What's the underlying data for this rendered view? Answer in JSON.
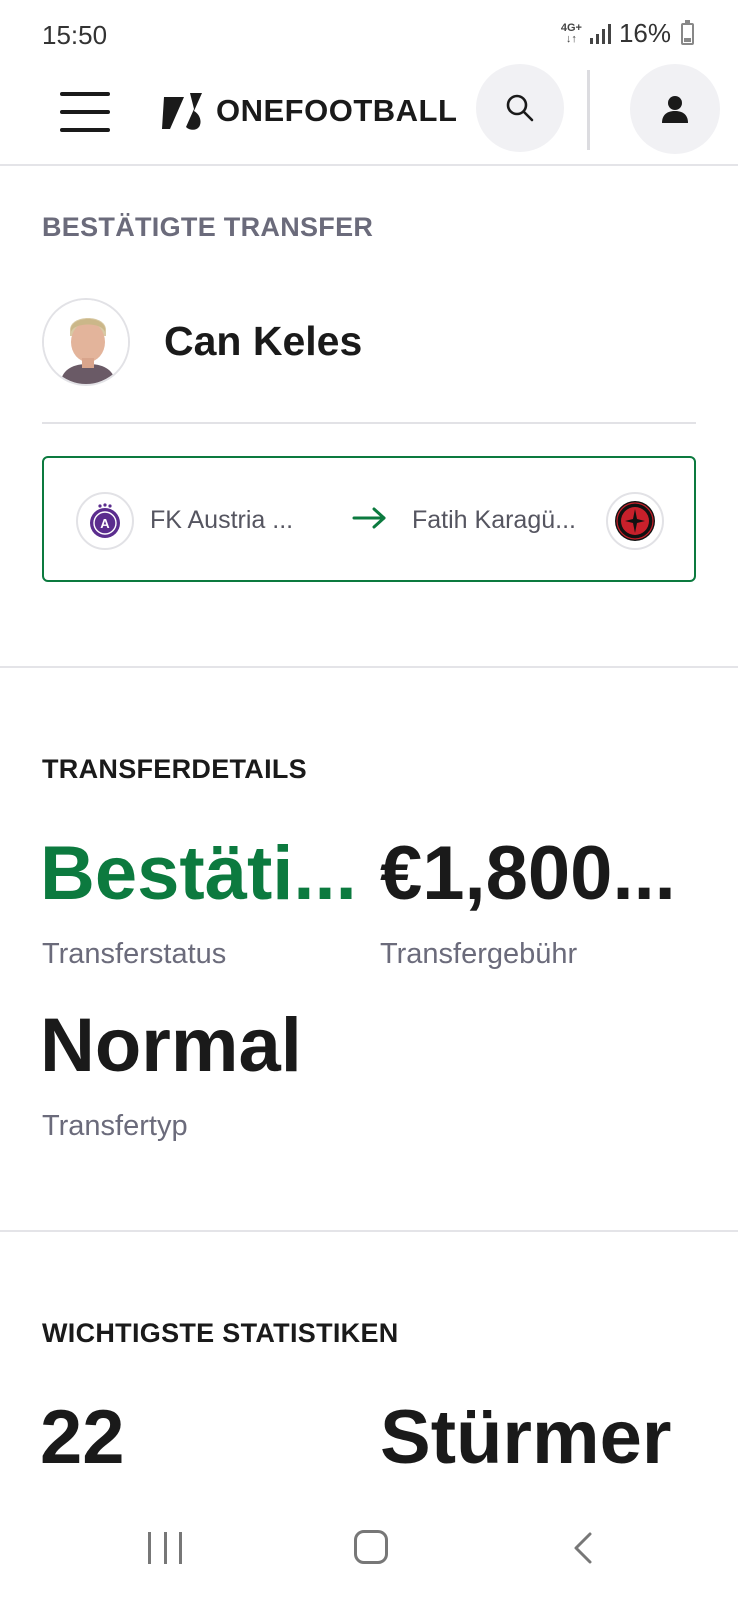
{
  "status_bar": {
    "time": "15:50",
    "network": "4G+",
    "battery": "16%"
  },
  "header": {
    "brand": "ONEFOOTBALL",
    "menu_icon": "hamburger-menu-icon",
    "search_icon": "search-icon",
    "profile_icon": "user-icon"
  },
  "confirmed_transfer": {
    "label": "BESTÄTIGTE TRANSFER",
    "player_name": "Can Keles",
    "from_club": "FK Austria ...",
    "to_club": "Fatih Karagü...",
    "accent_color": "#0c7a3f"
  },
  "transfer_details": {
    "heading": "TRANSFERDETAILS",
    "status_value": "Bestäti...",
    "status_caption": "Transferstatus",
    "fee_value": "€1,800...",
    "fee_caption": "Transfergebühr",
    "type_value": "Normal",
    "type_caption": "Transfertyp"
  },
  "key_stats": {
    "heading": "WICHTIGSTE STATISTIKEN",
    "age_value": "22",
    "position_value": "Stürmer"
  }
}
